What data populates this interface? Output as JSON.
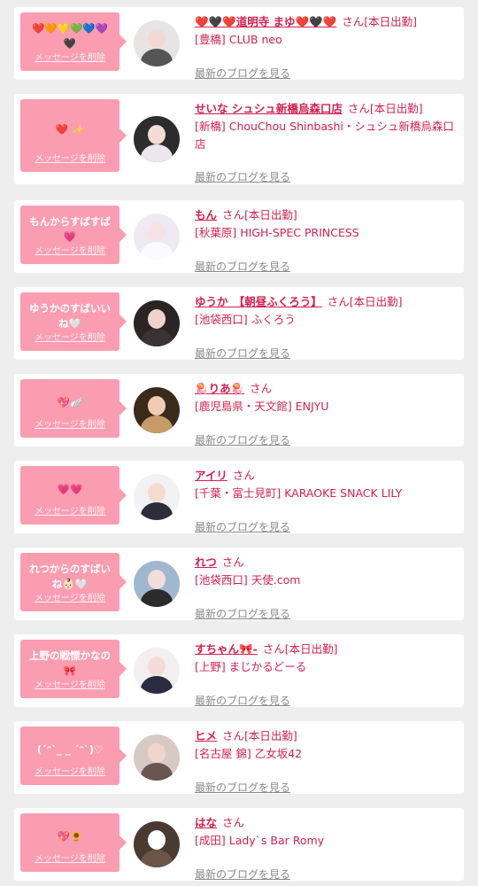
{
  "delete_label": "メッセージを削除",
  "san_label": "さん",
  "blog_label": "最新のブログを見る",
  "colors": {
    "accent": "#d2214f",
    "bubble": "#fa9db0",
    "background": "#eeeeee"
  },
  "entries": [
    {
      "message": "❤️🧡💛💚💙💜\n🖤",
      "name": "❤️🖤❤️道明寺 まゆ❤️🖤❤️",
      "status": "[本日出勤]",
      "shop": "[豊橋] CLUB neo",
      "avatar_icon": "avatar-icon"
    },
    {
      "message": "❤️ ✨",
      "name": "せいな シュシュ新橋烏森口店",
      "status": "[本日出勤]",
      "shop": "[新橋] ChouChou Shinbashi・シュシュ新橋烏森口店",
      "avatar_icon": "avatar-icon"
    },
    {
      "message": "もんからすばすば\n💗",
      "name": "もん",
      "status": "[本日出勤]",
      "shop": "[秋葉原] HIGH-SPEC PRINCESS",
      "avatar_icon": "avatar-icon"
    },
    {
      "message": "ゆうかのすばいい\nね🤍",
      "name": "ゆうか　【朝昼ふくろう】",
      "status": "[本日出勤]",
      "shop": "[池袋西口] ふくろう",
      "avatar_icon": "avatar-icon"
    },
    {
      "message": "💖🪽",
      "name": "🪼りあ🪼",
      "status": "",
      "shop": "[鹿児島県・天文館] ENJYU",
      "avatar_icon": "avatar-icon"
    },
    {
      "message": "💗💗",
      "name": "アイリ",
      "status": "",
      "shop": "[千葉・富士見町] KARAOKE SNACK LILY",
      "avatar_icon": "avatar-icon"
    },
    {
      "message": "れつからのすばい\nね👶🏻🤍",
      "name": "れつ",
      "status": "",
      "shop": "[池袋西口] 天使.com",
      "avatar_icon": "avatar-icon"
    },
    {
      "message": "上野の戦慄かなの\n🎀",
      "name": "すちゃん🎀-",
      "status": "[本日出勤]",
      "shop": "[上野] まじかるどーる",
      "avatar_icon": "avatar-icon"
    },
    {
      "message": "(ˊᵔˋ_ _ ˊᵔˋ)♡",
      "name": "ヒメ",
      "status": "[本日出勤]",
      "shop": "[名古屋 錦] 乙女坂42",
      "avatar_icon": "avatar-icon"
    },
    {
      "message": "💖🌻",
      "name": "はな",
      "status": "",
      "shop": "[成田] Lady`s Bar Romy",
      "avatar_icon": "avatar-icon"
    }
  ]
}
